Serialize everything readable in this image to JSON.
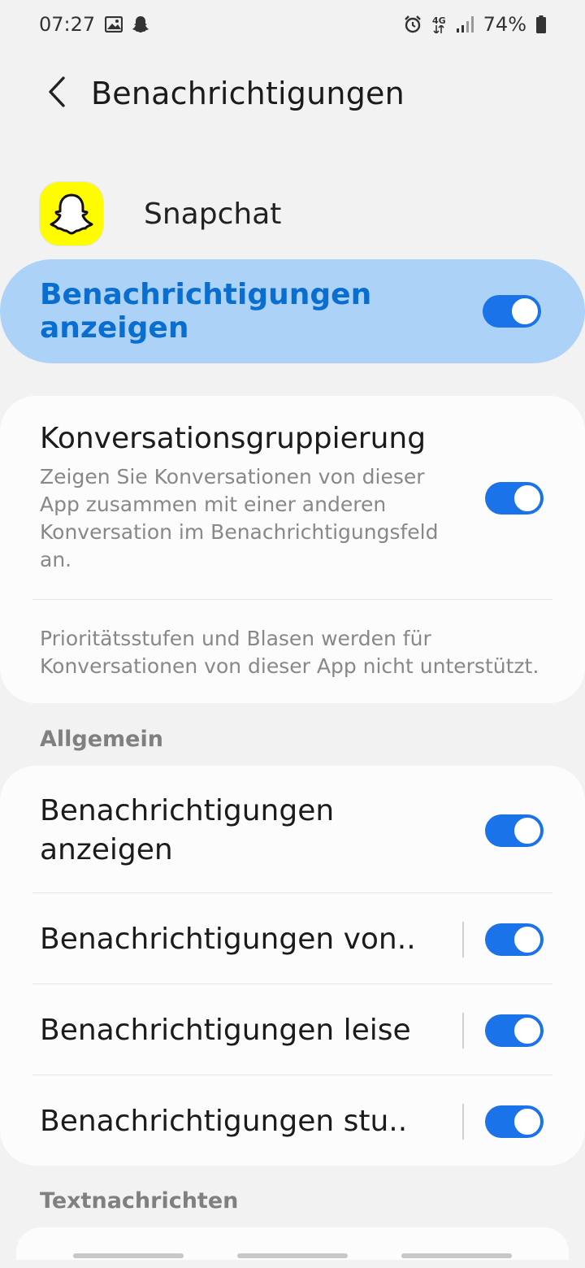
{
  "status_bar": {
    "time": "07:27",
    "battery": "74%",
    "network": "4G",
    "icons": [
      "image-icon",
      "snapchat-notification-icon",
      "alarm-icon",
      "network-4g-icon",
      "signal-icon",
      "battery-icon"
    ]
  },
  "app_bar": {
    "title": "Benachrichtigungen",
    "back_icon": "back-arrow-icon"
  },
  "app": {
    "name": "Snapchat",
    "icon": "snapchat-ghost-icon",
    "icon_color": "#fffc00"
  },
  "master_toggle": {
    "label": "Benachrichtigungen anzeigen",
    "enabled": true
  },
  "conversation": {
    "title": "Konversationsgruppierung",
    "description": "Zeigen Sie Konversationen von dieser App zusammen mit einer anderen Konversation im Benachrichtigungsfeld an.",
    "enabled": true,
    "note": "Prioritätsstufen und Blasen werden für Konversationen von dieser App nicht unterstützt."
  },
  "sections": {
    "general": "Allgemein",
    "text_messages": "Textnachrichten"
  },
  "general_items": [
    {
      "label": "Benachrichtigungen anzeigen",
      "enabled": true
    },
    {
      "label": "Benachrichtigungen von..",
      "enabled": true
    },
    {
      "label": "Benachrichtigungen leise",
      "enabled": true
    },
    {
      "label": "Benachrichtigungen stu..",
      "enabled": true
    }
  ],
  "colors": {
    "accent": "#1a73e8",
    "highlight": "#acd3f7",
    "highlight_text": "#0a6ed1"
  }
}
